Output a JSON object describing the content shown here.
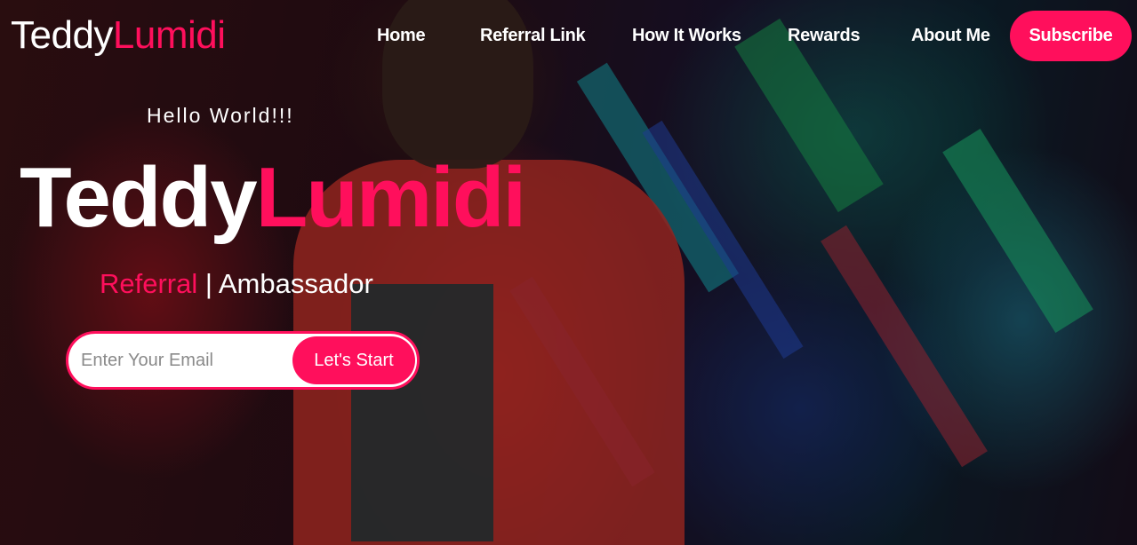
{
  "brand": {
    "first": "Teddy",
    "second": "Lumidi"
  },
  "nav": {
    "items": [
      {
        "label": "Home"
      },
      {
        "label": "Referral Link"
      },
      {
        "label": "How It Works"
      },
      {
        "label": "Rewards"
      },
      {
        "label": "About Me"
      }
    ],
    "subscribe_label": "Subscribe"
  },
  "hero": {
    "greeting": "Hello World!!!",
    "title_first": "Teddy",
    "title_second": "Lumidi",
    "tagline_accent": "Referral",
    "tagline_rest": " | Ambassador"
  },
  "signup": {
    "email_placeholder": "Enter Your Email",
    "email_value": "",
    "button_label": "Let's Start"
  },
  "colors": {
    "accent": "#ff0f5c",
    "text": "#ffffff"
  }
}
